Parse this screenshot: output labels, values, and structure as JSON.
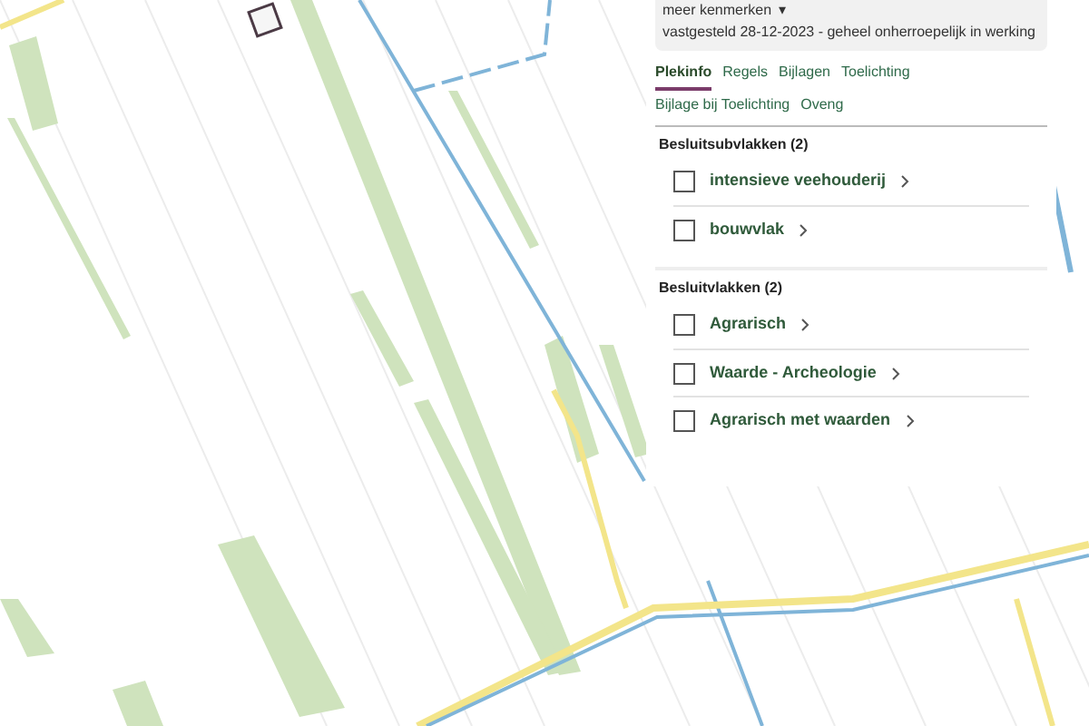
{
  "header": {
    "more_link": "meer kenmerken",
    "caret": "▾",
    "status": "vastgesteld 28-12-2023 - geheel onherroepelijk in werking"
  },
  "tabs": [
    {
      "label": "Plekinfo",
      "selected": true
    },
    {
      "label": "Regels",
      "selected": false
    },
    {
      "label": "Bijlagen",
      "selected": false
    },
    {
      "label": "Toelichting",
      "selected": false
    },
    {
      "label": "Bijlage bij Toelichting",
      "selected": false
    },
    {
      "label": "Oveng",
      "selected": false
    }
  ],
  "sections": [
    {
      "title": "Besluitsubvlakken (2)",
      "items": [
        {
          "label": "intensieve veehouderij",
          "checked": false
        },
        {
          "label": "bouwvlak",
          "checked": false
        }
      ]
    },
    {
      "title": "Besluitvlakken (2)",
      "items": [
        {
          "label": "Agrarisch",
          "checked": false
        },
        {
          "label": "Waarde - Archeologie",
          "checked": false
        },
        {
          "label": "Agrarisch met waarden",
          "checked": false
        }
      ]
    }
  ]
}
